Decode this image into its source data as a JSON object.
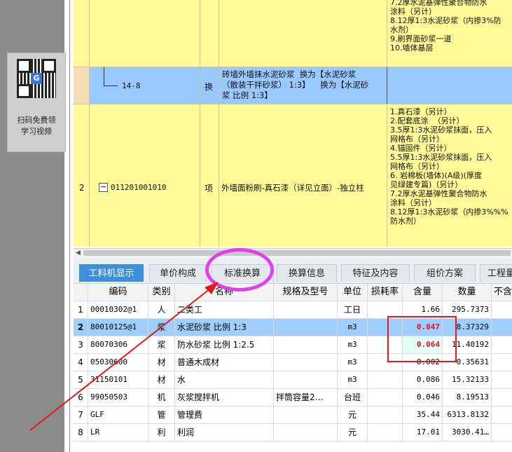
{
  "sidebar": {
    "qr_caption_line1": "扫码免费领",
    "qr_caption_line2": "学习视频",
    "qr_center": "G"
  },
  "upper_table": {
    "row_top": {
      "desc_lines": [
        "7.2厚水泥基弹性聚合物防水",
        "涂料（另计）",
        "8.12厚1:3水泥砂浆（内掺3%防",
        "水剂）",
        "9.刷界面砂浆一道",
        "10.墙体基层"
      ]
    },
    "row_sub": {
      "code": "14-8",
      "type": "换",
      "name_lines": [
        "砖墙外墙抹水泥砂浆  换为【水泥砂浆",
        "（散装干拌砂浆） 1:3】    换为【水泥砂",
        "浆 比例 1:3】"
      ]
    },
    "row_2": {
      "index": "2",
      "toggle": "−",
      "code": "011201001010",
      "type": "项",
      "name": "外墙面粉刷-真石漆（详见立面）-独立柱",
      "desc_lines": [
        "1.真石漆（另计）",
        "2.配套底涂  （另计）",
        "3.5厚1:3水泥砂浆抹面，压入",
        "网格布（另计）",
        "4.锚固件（另计）",
        "5.5厚1:3水泥砂浆抹面，压入",
        "网格布（另计）",
        "6. 岩棉板(墙体)(A级)(厚度",
        "见绿建专篇)（另计）",
        "7.2厚水泥基弹性聚合物防水",
        "涂料（另计）",
        "8.12厚1:3水泥砂浆（内掺3%%%",
        "防水剂）"
      ]
    }
  },
  "tabs": [
    {
      "label": "工料机显示"
    },
    {
      "label": "单价构成"
    },
    {
      "label": "标准换算"
    },
    {
      "label": "换算信息"
    },
    {
      "label": "特征及内容"
    },
    {
      "label": "组价方案"
    },
    {
      "label": "工程量明"
    }
  ],
  "grid": {
    "headers": [
      "",
      "编码",
      "类别",
      "名称",
      "规格及型号",
      "单位",
      "损耗率",
      "含量",
      "数量",
      "不含"
    ],
    "rows": [
      {
        "idx": "1",
        "code": "00010302@1",
        "cat": "人",
        "name": "二类工",
        "spec": "",
        "unit": "工日",
        "loss": "",
        "content": "1.66",
        "qty": "295.7373"
      },
      {
        "idx": "2",
        "code": "80010125@1",
        "cat": "浆",
        "name": "水泥砂浆 比例 1:3",
        "spec": "",
        "unit": "m3",
        "loss": "",
        "content": "0.047",
        "qty": "8.37329"
      },
      {
        "idx": "3",
        "code": "80070306",
        "cat": "浆",
        "name": "防水砂浆 比例 1:2.5",
        "spec": "",
        "unit": "m3",
        "loss": "",
        "content": "0.064",
        "qty": "11.40192"
      },
      {
        "idx": "4",
        "code": "05030600",
        "cat": "材",
        "name": "普通木成材",
        "spec": "",
        "unit": "m3",
        "loss": "",
        "content": "0.002",
        "qty": "0.35631"
      },
      {
        "idx": "5",
        "code": "31150101",
        "cat": "材",
        "name": "水",
        "spec": "",
        "unit": "m3",
        "loss": "",
        "content": "0.086",
        "qty": "15.32133"
      },
      {
        "idx": "6",
        "code": "99050503",
        "cat": "机",
        "name": "灰浆搅拌机",
        "spec": "拌筒容量2…",
        "unit": "台班",
        "loss": "",
        "content": "0.046",
        "qty": "8.19513"
      },
      {
        "idx": "7",
        "code": "GLF",
        "cat": "管",
        "name": "管理费",
        "spec": "",
        "unit": "元",
        "loss": "",
        "content": "35.44",
        "qty": "6313.8132"
      },
      {
        "idx": "8",
        "code": "LR",
        "cat": "利",
        "name": "利润",
        "spec": "",
        "unit": "元",
        "loss": "",
        "content": "17.01",
        "qty": "3030.41…"
      }
    ]
  },
  "colors": {
    "annotation_ellipse": "#e040ea",
    "annotation_box": "#e01919",
    "highlight_value": "#e8102a",
    "active_tab": "#3d8fd9"
  }
}
